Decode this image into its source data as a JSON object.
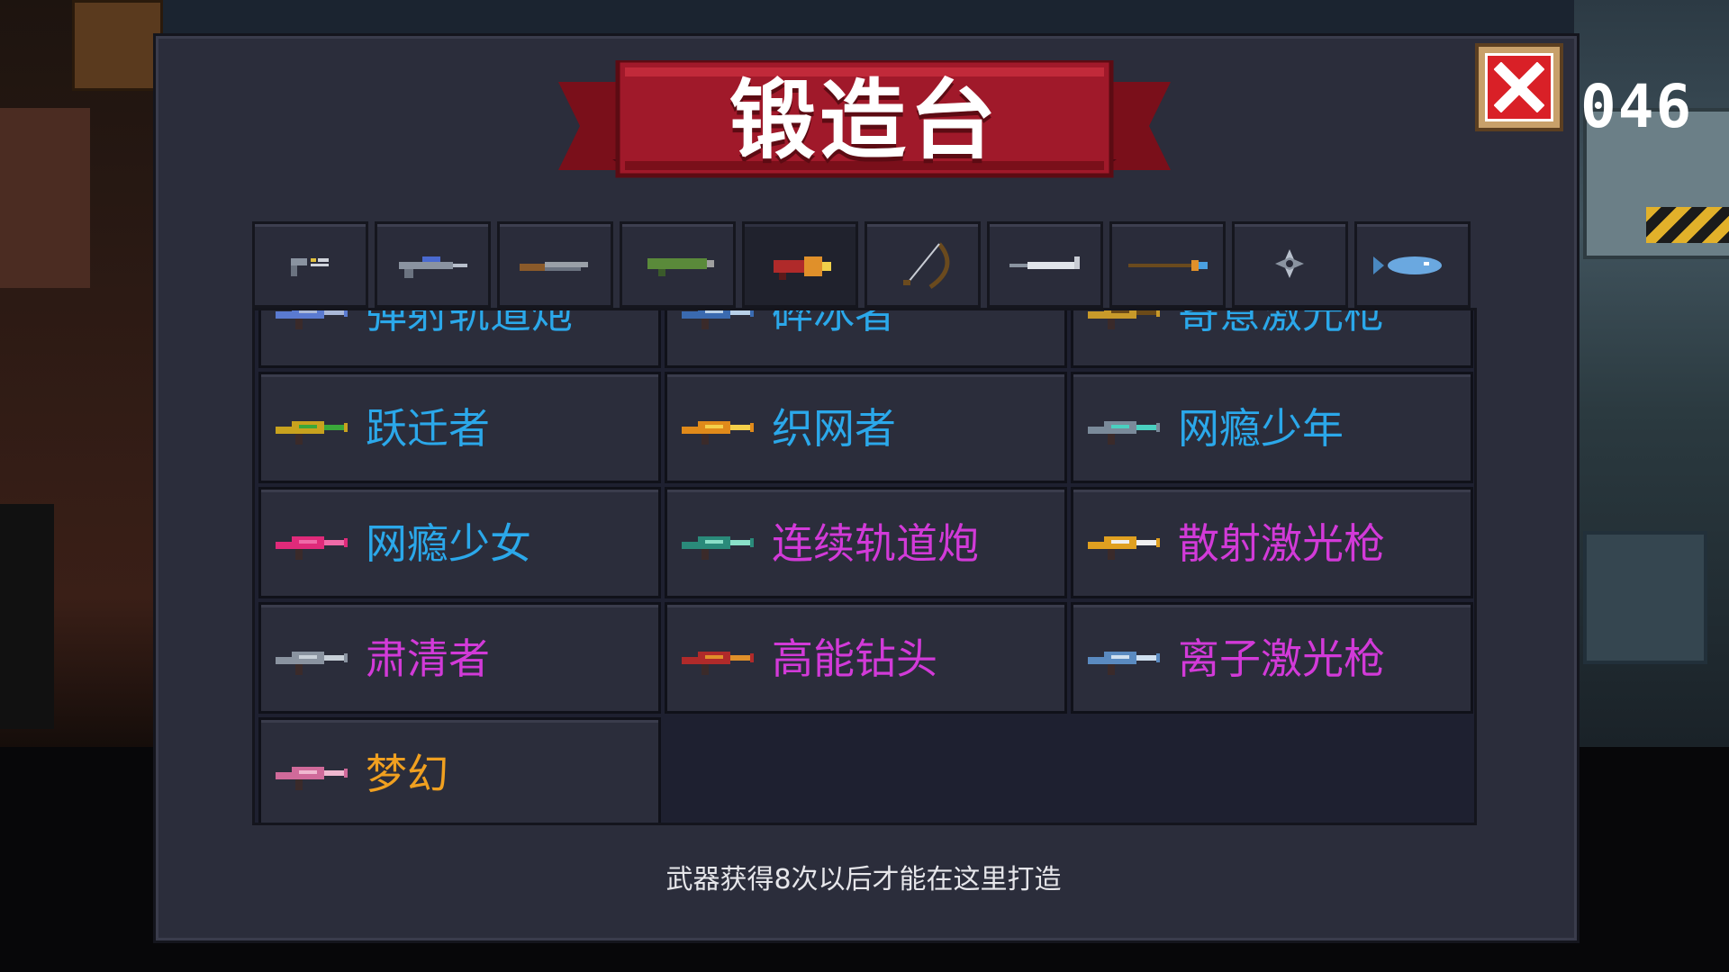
{
  "header": {
    "title": "锻造台",
    "score_fragment": "046",
    "close_label": "close"
  },
  "tabs": [
    {
      "icon": "pistol-icon",
      "active": false
    },
    {
      "icon": "rifle-icon",
      "active": false
    },
    {
      "icon": "shotgun-icon",
      "active": false
    },
    {
      "icon": "rocket-launcher-icon",
      "active": false
    },
    {
      "icon": "laser-gun-icon",
      "active": true
    },
    {
      "icon": "bow-icon",
      "active": false
    },
    {
      "icon": "sword-icon",
      "active": false
    },
    {
      "icon": "staff-icon",
      "active": false
    },
    {
      "icon": "shuriken-icon",
      "active": false
    },
    {
      "icon": "fish-icon",
      "active": false
    }
  ],
  "items": [
    {
      "name": "弹射轨道炮",
      "color": "#2ba8ea",
      "icon": "railgun-icon",
      "c1": "#5a7ad0",
      "c2": "#a9b8d8"
    },
    {
      "name": "碎冰者",
      "color": "#2ba8ea",
      "icon": "ice-gun-icon",
      "c1": "#3a6ab0",
      "c2": "#b8d0e8"
    },
    {
      "name": "寄意激光枪",
      "color": "#2ba8ea",
      "icon": "gold-laser-icon",
      "c1": "#c89a2a",
      "c2": "#6b4a18"
    },
    {
      "name": "跃迁者",
      "color": "#2ba8ea",
      "icon": "leaper-gun-icon",
      "c1": "#c8a21e",
      "c2": "#3aa83a"
    },
    {
      "name": "织网者",
      "color": "#2ba8ea",
      "icon": "weaver-gun-icon",
      "c1": "#e08a1a",
      "c2": "#f4d04a"
    },
    {
      "name": "网瘾少年",
      "color": "#2ba8ea",
      "icon": "net-boy-gun-icon",
      "c1": "#7a8a9a",
      "c2": "#4ad0c0"
    },
    {
      "name": "网瘾少女",
      "color": "#2ba8ea",
      "icon": "net-girl-gun-icon",
      "c1": "#e02a7a",
      "c2": "#f06aa8"
    },
    {
      "name": "连续轨道炮",
      "color": "#d23ad8",
      "icon": "rail-cannon-icon",
      "c1": "#2a8a7a",
      "c2": "#8ae0c8"
    },
    {
      "name": "散射激光枪",
      "color": "#d23ad8",
      "icon": "scatter-laser-icon",
      "c1": "#e0a020",
      "c2": "#f0f0f0"
    },
    {
      "name": "肃清者",
      "color": "#d23ad8",
      "icon": "purger-gun-icon",
      "c1": "#8a93a0",
      "c2": "#c8d0d8"
    },
    {
      "name": "高能钻头",
      "color": "#d23ad8",
      "icon": "drill-gun-icon",
      "c1": "#b02a2a",
      "c2": "#e0902a"
    },
    {
      "name": "离子激光枪",
      "color": "#d23ad8",
      "icon": "ion-laser-icon",
      "c1": "#5a8ac0",
      "c2": "#d0e0f0"
    },
    {
      "name": "梦幻",
      "color": "#f0a020",
      "icon": "dream-gun-icon",
      "c1": "#d06a9a",
      "c2": "#f0b8d0"
    }
  ],
  "footer": {
    "hint": "武器获得8次以后才能在这里打造"
  }
}
